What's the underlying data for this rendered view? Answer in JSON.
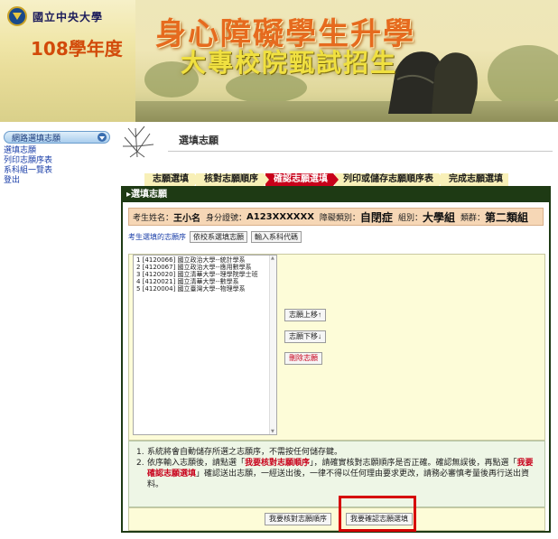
{
  "banner": {
    "university": "國立中央大學",
    "year": "108學年度",
    "title_main": "身心障礙學生升學",
    "title_sub": "大專校院甄試招生"
  },
  "sidebar": {
    "header": "網路選填志願",
    "items": [
      {
        "label": "選填志願"
      },
      {
        "label": "列印志願序表"
      },
      {
        "label": "系科組一覽表"
      },
      {
        "label": "登出"
      }
    ]
  },
  "page": {
    "title": "選填志願"
  },
  "steps": [
    {
      "label": "志願選填",
      "active": false
    },
    {
      "label": "核對志願順序",
      "active": false
    },
    {
      "label": "確認志願選填",
      "active": true
    },
    {
      "label": "列印或儲存志願順序表",
      "active": false
    },
    {
      "label": "完成志願選填",
      "active": false
    }
  ],
  "panel": {
    "header": "▸選填志願",
    "student": {
      "name_label": "考生姓名：",
      "name": "王小名",
      "id_label": "身分證號：",
      "id": "A123XXXXXX",
      "disability_label": "障礙類別：",
      "disability": "自閉症",
      "group_label": "組別：",
      "group": "大學組",
      "category_label": "類群：",
      "category": "第二類組"
    },
    "tabs_label": "考生選填的志願序",
    "tabs": [
      "依校系選填志願",
      "輸入系科代碼"
    ],
    "choices": [
      "1 [4120066]  國立政治大學--統計學系",
      "2 [4120067]  國立政治大學--應用數學系",
      "3 [4120020]  國立清華大學--理學院學士班",
      "4 [4120021]  國立清華大學--數學系",
      "5 [4120004]  國立臺灣大學--物理學系"
    ],
    "actions": {
      "up": "志願上移↑",
      "down": "志願下移↓",
      "delete": "刪除志願"
    },
    "notes": {
      "n1": "1.",
      "note1": "系統將會自動儲存所選之志願序，不需按任何儲存鍵。",
      "n2": "2.",
      "note2_a": "依序輸入志願後，請點選「",
      "note2_hl1": "我要核對志願順序",
      "note2_b": "」，請確實核對志願順序是否正確。確認無誤後，再點選「",
      "note2_hl2": "我要確認志願選填",
      "note2_c": "」確認送出志願，一經送出後，一律不得以任何理由要求更改，請務必審慎考量後再行送出資料。"
    },
    "buttons": {
      "verify": "我要核對志願順序",
      "confirm": "我要確認志願選填"
    }
  }
}
